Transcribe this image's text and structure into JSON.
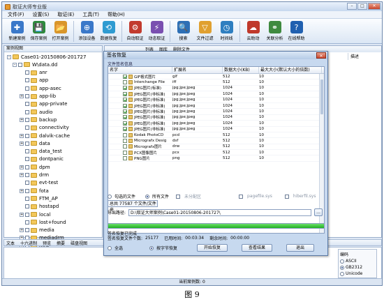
{
  "app": {
    "title": "取证大师专业版",
    "win_min": "–",
    "win_max": "□",
    "win_close": "✕"
  },
  "menu": [
    "文件(F)",
    "设置(S)",
    "取证(E)",
    "工具(T)",
    "帮助(H)"
  ],
  "toolbar": [
    {
      "label": "新建案例",
      "icon": "new-case-icon",
      "color": "#3a78c9"
    },
    {
      "label": "保存案例",
      "icon": "save-case-icon",
      "color": "#2d8a3d"
    },
    {
      "label": "打开案例",
      "icon": "open-case-icon",
      "color": "#d9962a"
    },
    {
      "label": "添加设备",
      "icon": "add-device-icon",
      "color": "#3a78c9"
    },
    {
      "label": "数据恢复",
      "icon": "data-recovery-icon",
      "color": "#2f9bd1"
    },
    {
      "label": "自动取证",
      "icon": "auto-forensics-icon",
      "color": "#c23b2e"
    },
    {
      "label": "动态取证",
      "icon": "live-forensics-icon",
      "color": "#7a4fb0"
    },
    {
      "label": "搜索",
      "icon": "search-icon",
      "color": "#2d6fb5"
    },
    {
      "label": "文件过滤",
      "icon": "file-filter-icon",
      "color": "#e0a030"
    },
    {
      "label": "时间线",
      "icon": "timeline-icon",
      "color": "#2f7fc0"
    },
    {
      "label": "云助动",
      "icon": "cloud-icon",
      "color": "#c0392b"
    },
    {
      "label": "关联分析",
      "icon": "correlation-icon",
      "color": "#3f8a3f"
    },
    {
      "label": "在线帮助",
      "icon": "online-help-icon",
      "color": "#2060b0"
    }
  ],
  "left_pane": {
    "header": "案例视图",
    "tree": {
      "case": "Case01-20150806-201727",
      "root": "W\\data.dd",
      "folders": [
        "anr",
        "app",
        "app-asec",
        "app-lib",
        "app-private",
        "audio",
        "backup",
        "connectivity",
        "dalvik-cache",
        "data",
        "data_test",
        "dontpanic",
        "dpm",
        "drm",
        "evt-test",
        "fota",
        "FTM_AP",
        "hostapd",
        "local",
        "lost+found",
        "media",
        "mediadrm",
        "misc"
      ]
    }
  },
  "right_pane": {
    "tabs": [
      "列表",
      "图库",
      "删除文件"
    ],
    "col_signature": "签名",
    "col_desc": "描述"
  },
  "bottom": {
    "tabs": [
      "文本",
      "十六进制",
      "预览",
      "摘要",
      "磁盘视图"
    ],
    "encoding": {
      "label": "编码",
      "options": [
        "ASCII",
        "GB2312",
        "Unicode"
      ]
    }
  },
  "status": "当前案例数: 0",
  "caption": "图 9",
  "dialog": {
    "title": "签名恢复",
    "close": "✕",
    "group": "文件签名信息",
    "columns": [
      "名字",
      "扩展名",
      "数据大小(KB)",
      "最大大小(默认大小的倍数)"
    ],
    "rows": [
      {
        "on": true,
        "name": "GIF格式图片",
        "ext": "gif",
        "size": "512",
        "max": "10"
      },
      {
        "on": false,
        "name": "Interchange File",
        "ext": "iff",
        "size": "512",
        "max": "10"
      },
      {
        "on": true,
        "name": "JPEG图片(标准)",
        "ext": "jpg;jpe;jpeg",
        "size": "1024",
        "max": "10"
      },
      {
        "on": true,
        "name": "JPEG图片(非标准)",
        "ext": "jpg;jpe;jpeg",
        "size": "1024",
        "max": "10"
      },
      {
        "on": true,
        "name": "JPEG图片(非标准)",
        "ext": "jpg;jpe;jpeg",
        "size": "1024",
        "max": "10"
      },
      {
        "on": true,
        "name": "JPEG图片(非标准)",
        "ext": "jpg;jpe;jpeg",
        "size": "1024",
        "max": "10"
      },
      {
        "on": true,
        "name": "JPEG图片(非标准)",
        "ext": "jpg;jpe;jpeg",
        "size": "1024",
        "max": "10"
      },
      {
        "on": true,
        "name": "JPEG图片(非标准)",
        "ext": "jpg;jpe;jpeg",
        "size": "1024",
        "max": "10"
      },
      {
        "on": true,
        "name": "JPEG图片(非标准)",
        "ext": "jpg;jpe;jpeg",
        "size": "1024",
        "max": "10"
      },
      {
        "on": true,
        "name": "JPEG图片(非标准)",
        "ext": "jpg;jpe;jpeg",
        "size": "1024",
        "max": "10"
      },
      {
        "on": false,
        "name": "Kodak PhotoCD",
        "ext": "pcd",
        "size": "512",
        "max": "10"
      },
      {
        "on": false,
        "name": "Micrografx Desig",
        "ext": "dsf",
        "size": "512",
        "max": "10"
      },
      {
        "on": false,
        "name": "Micrografx图片",
        "ext": "drw",
        "size": "512",
        "max": "10"
      },
      {
        "on": false,
        "name": "PCX图像图片",
        "ext": "pcx",
        "size": "512",
        "max": "10"
      },
      {
        "on": false,
        "name": "PNG图片",
        "ext": "png",
        "size": "512",
        "max": "10"
      }
    ],
    "options": {
      "selected_files": "勾选的文件",
      "all_files": "所有文件",
      "unallocated": "未分配区",
      "pagefile": "pagefile.sys",
      "hiberfil": "hiberfil.sys"
    },
    "total": "总共 77587 个文件/文件夹",
    "export_label": "导出路径:",
    "export_path": "D:\\取证大师案例\\Case01-20150806-201727\\",
    "browse": "...",
    "progress": 100,
    "done": "签名恢复已完成",
    "stats": {
      "count_label": "签名恢复文件个数:",
      "count": "25177",
      "elapsed_label": "已用时间:",
      "elapsed": "00:03:34",
      "remain_label": "剩余时间:",
      "remain": "00:00:00"
    },
    "full_select": "全选",
    "by_chars": "按字节恢复",
    "start": "开始恢复",
    "view_result": "查看结果",
    "exit": "退出"
  }
}
